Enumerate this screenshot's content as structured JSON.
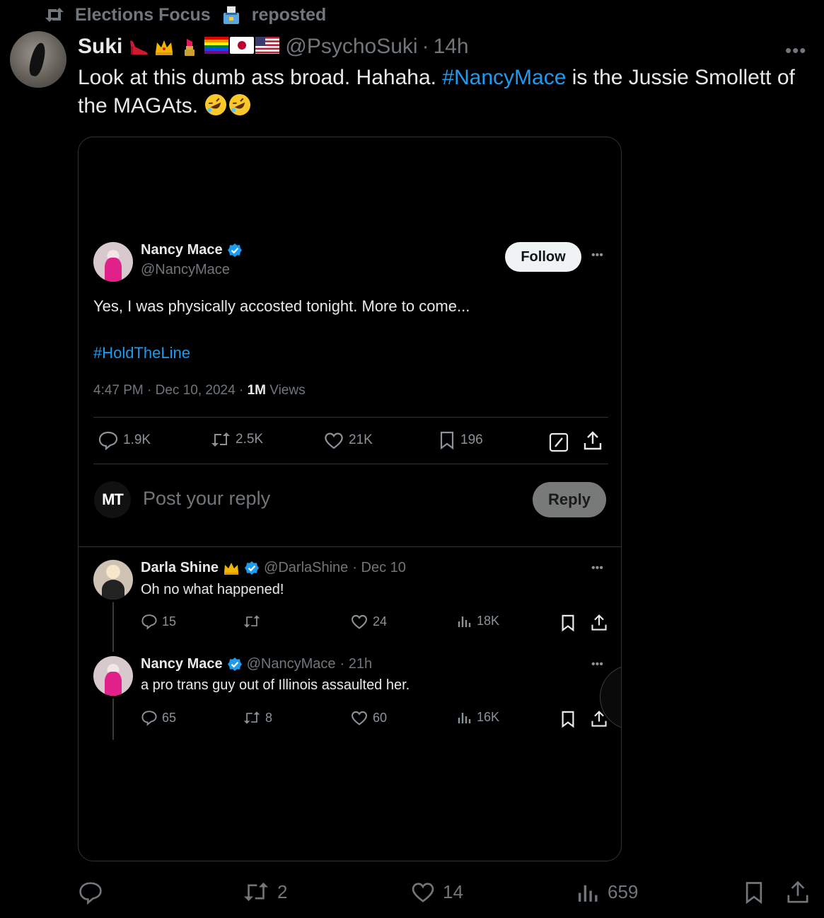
{
  "repost": {
    "account": "Elections Focus",
    "label": "reposted"
  },
  "tweet": {
    "author_name": "Suki",
    "handle": "@PsychoSuki",
    "dot": "·",
    "time": "14h",
    "text_before": "Look at this dumb ass broad. Hahaha. ",
    "hashtag": "#NancyMace",
    "text_after": " is the Jussie Smollett of the MAGAts.",
    "emojis": [
      "high-heel",
      "crown",
      "lipstick",
      "rainbow-flag",
      "japan-flag",
      "us-flag"
    ]
  },
  "embedded": {
    "author_name": "Nancy Mace",
    "handle": "@NancyMace",
    "follow_label": "Follow",
    "text": "Yes, I was physically accosted tonight. More to come...",
    "hashtag": "#HoldTheLine",
    "timestamp": "4:47 PM · Dec 10, 2024 · ",
    "views_count": "1M",
    "views_label": " Views",
    "stats": {
      "replies": "1.9K",
      "reposts": "2.5K",
      "likes": "21K",
      "bookmarks": "196"
    },
    "reply_box": {
      "avatar_text": "MT",
      "placeholder": "Post your reply",
      "button": "Reply"
    },
    "replies": [
      {
        "name": "Darla Shine",
        "handle": "@DarlaShine",
        "time": "· Dec 10",
        "text": "Oh no what happened!",
        "replies": "15",
        "reposts": "",
        "likes": "24",
        "views": "18K"
      },
      {
        "name": "Nancy Mace",
        "handle": "@NancyMace",
        "time": "· 21h",
        "text": "a pro trans guy out of Illinois assaulted her.",
        "replies": "65",
        "reposts": "8",
        "likes": "60",
        "views": "16K"
      }
    ]
  },
  "actions": {
    "replies": "",
    "reposts": "2",
    "likes": "14",
    "views": "659"
  },
  "colors": {
    "background": "#000000",
    "link": "#1d9bf0",
    "muted": "#71767b",
    "text": "#e7e9ea"
  }
}
